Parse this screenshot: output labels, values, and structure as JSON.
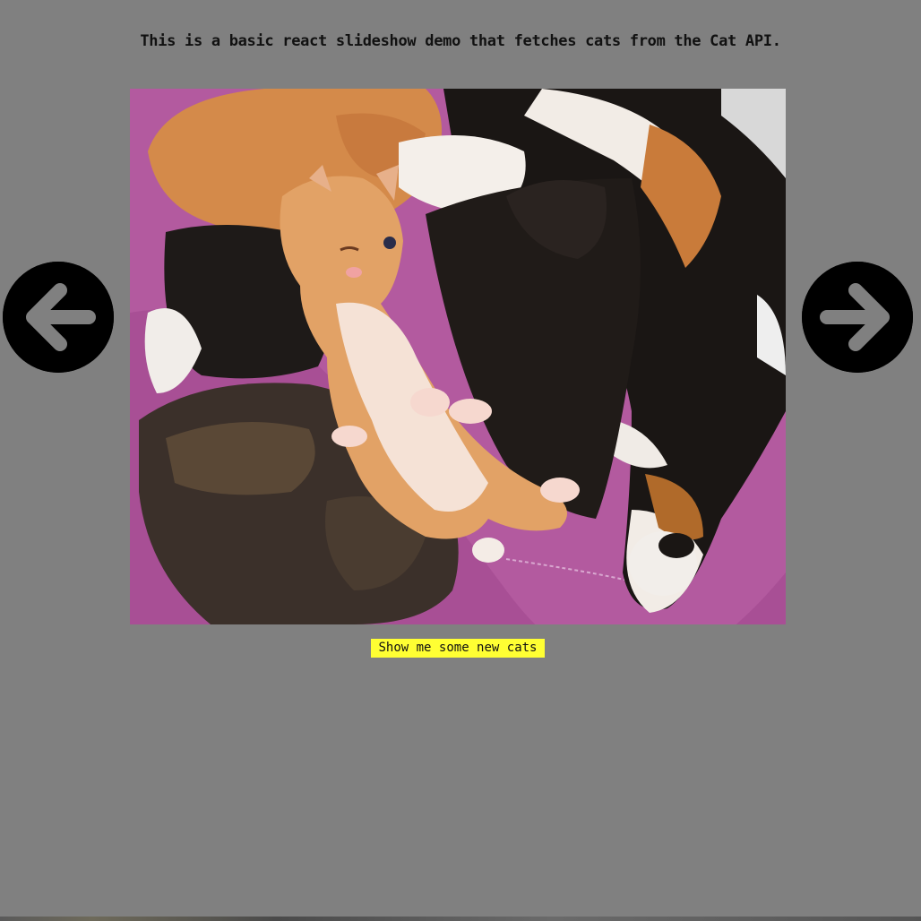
{
  "intro_text": "This is a basic react slideshow demo that fetches cats from the Cat API.",
  "slideshow": {
    "image_alt": "kittens",
    "prev_icon": "arrow-left-circle",
    "next_icon": "arrow-right-circle"
  },
  "new_cats_button": {
    "label": "Show me some new cats",
    "color": "#ffff33"
  },
  "colors": {
    "background": "#808080",
    "arrow_circle": "#000000",
    "arrow_glyph": "#808080"
  }
}
